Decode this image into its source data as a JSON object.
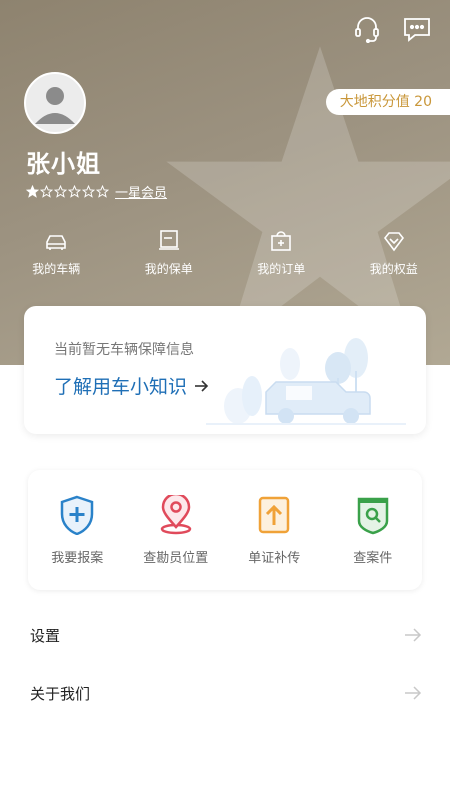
{
  "header": {
    "points_label": "大地积分值 20",
    "user_name": "张小姐",
    "member_level": "一星会员",
    "stars_filled": 1,
    "stars_total": 6,
    "icons": [
      "headset-icon",
      "message-icon"
    ]
  },
  "quick_nav": [
    {
      "label": "我的车辆",
      "icon": "car-icon"
    },
    {
      "label": "我的保单",
      "icon": "policy-icon"
    },
    {
      "label": "我的订单",
      "icon": "order-icon"
    },
    {
      "label": "我的权益",
      "icon": "rights-icon"
    }
  ],
  "info_card": {
    "text": "当前暂无车辆保障信息",
    "link": "了解用车小知识"
  },
  "services": [
    {
      "label": "我要报案",
      "icon": "report-shield-icon",
      "color": "#2a82c9"
    },
    {
      "label": "查勘员位置",
      "icon": "location-pin-icon",
      "color": "#e04a5b"
    },
    {
      "label": "单证补传",
      "icon": "upload-doc-icon",
      "color": "#f0a238"
    },
    {
      "label": "查案件",
      "icon": "search-case-icon",
      "color": "#3aa14a"
    }
  ],
  "menu": [
    {
      "label": "设置"
    },
    {
      "label": "关于我们"
    }
  ],
  "colors": {
    "header_bg": "#9c9280",
    "accent_blue": "#1f6fb6",
    "points_text": "#c9973a"
  }
}
